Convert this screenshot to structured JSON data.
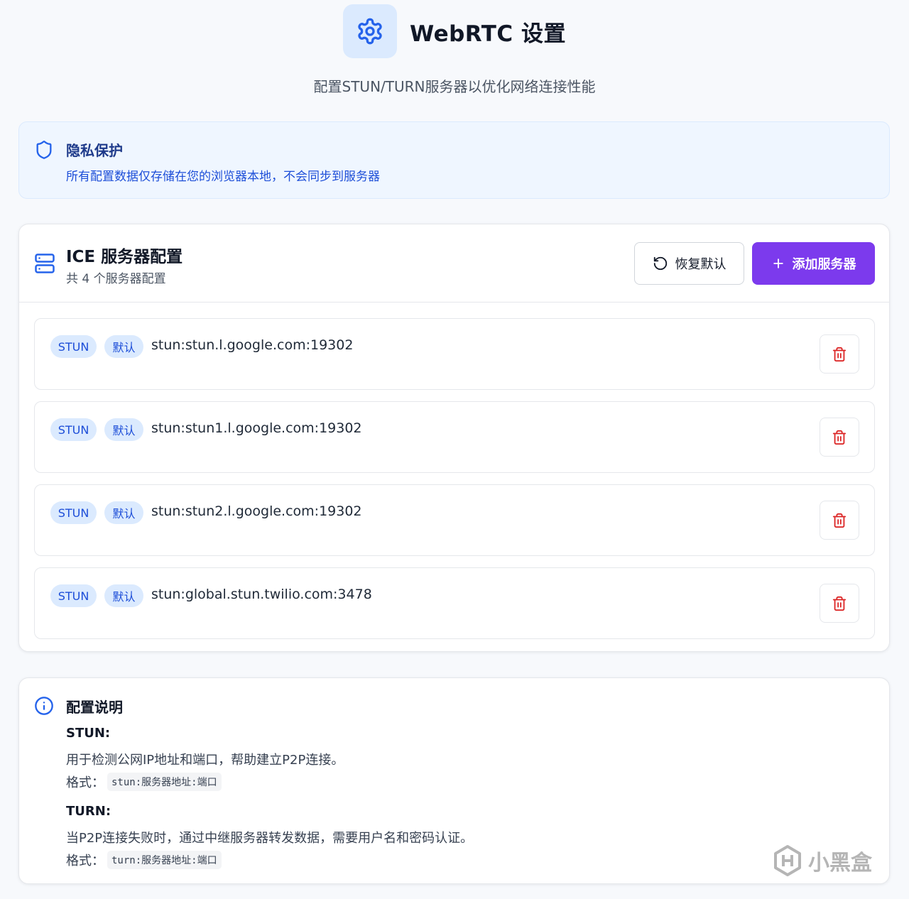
{
  "header": {
    "title": "WebRTC 设置",
    "subtitle": "配置STUN/TURN服务器以优化网络连接性能",
    "icon": "gear-icon"
  },
  "privacy": {
    "title": "隐私保护",
    "description": "所有配置数据仅存储在您的浏览器本地，不会同步到服务器",
    "icon": "shield-icon"
  },
  "ice": {
    "title": "ICE 服务器配置",
    "subtitle": "共 4 个服务器配置",
    "reset_label": "恢复默认",
    "add_label": "添加服务器",
    "servers": [
      {
        "type": "STUN",
        "tag": "默认",
        "url": "stun:stun.l.google.com:19302"
      },
      {
        "type": "STUN",
        "tag": "默认",
        "url": "stun:stun1.l.google.com:19302"
      },
      {
        "type": "STUN",
        "tag": "默认",
        "url": "stun:stun2.l.google.com:19302"
      },
      {
        "type": "STUN",
        "tag": "默认",
        "url": "stun:global.stun.twilio.com:3478"
      }
    ]
  },
  "info": {
    "title": "配置说明",
    "stun_heading": "STUN:",
    "stun_desc": "用于检测公网IP地址和端口，帮助建立P2P连接。",
    "format_label": "格式：",
    "stun_format": "stun:服务器地址:端口",
    "turn_heading": "TURN:",
    "turn_desc": "当P2P连接失败时，通过中继服务器转发数据，需要用户名和密码认证。",
    "turn_format": "turn:服务器地址:端口"
  },
  "watermark": "小黑盒",
  "colors": {
    "accent": "#7c3aed",
    "badge_bg": "#dbeafe",
    "badge_text": "#1d4ed8",
    "danger": "#dc2626",
    "info_blue": "#2563eb"
  }
}
